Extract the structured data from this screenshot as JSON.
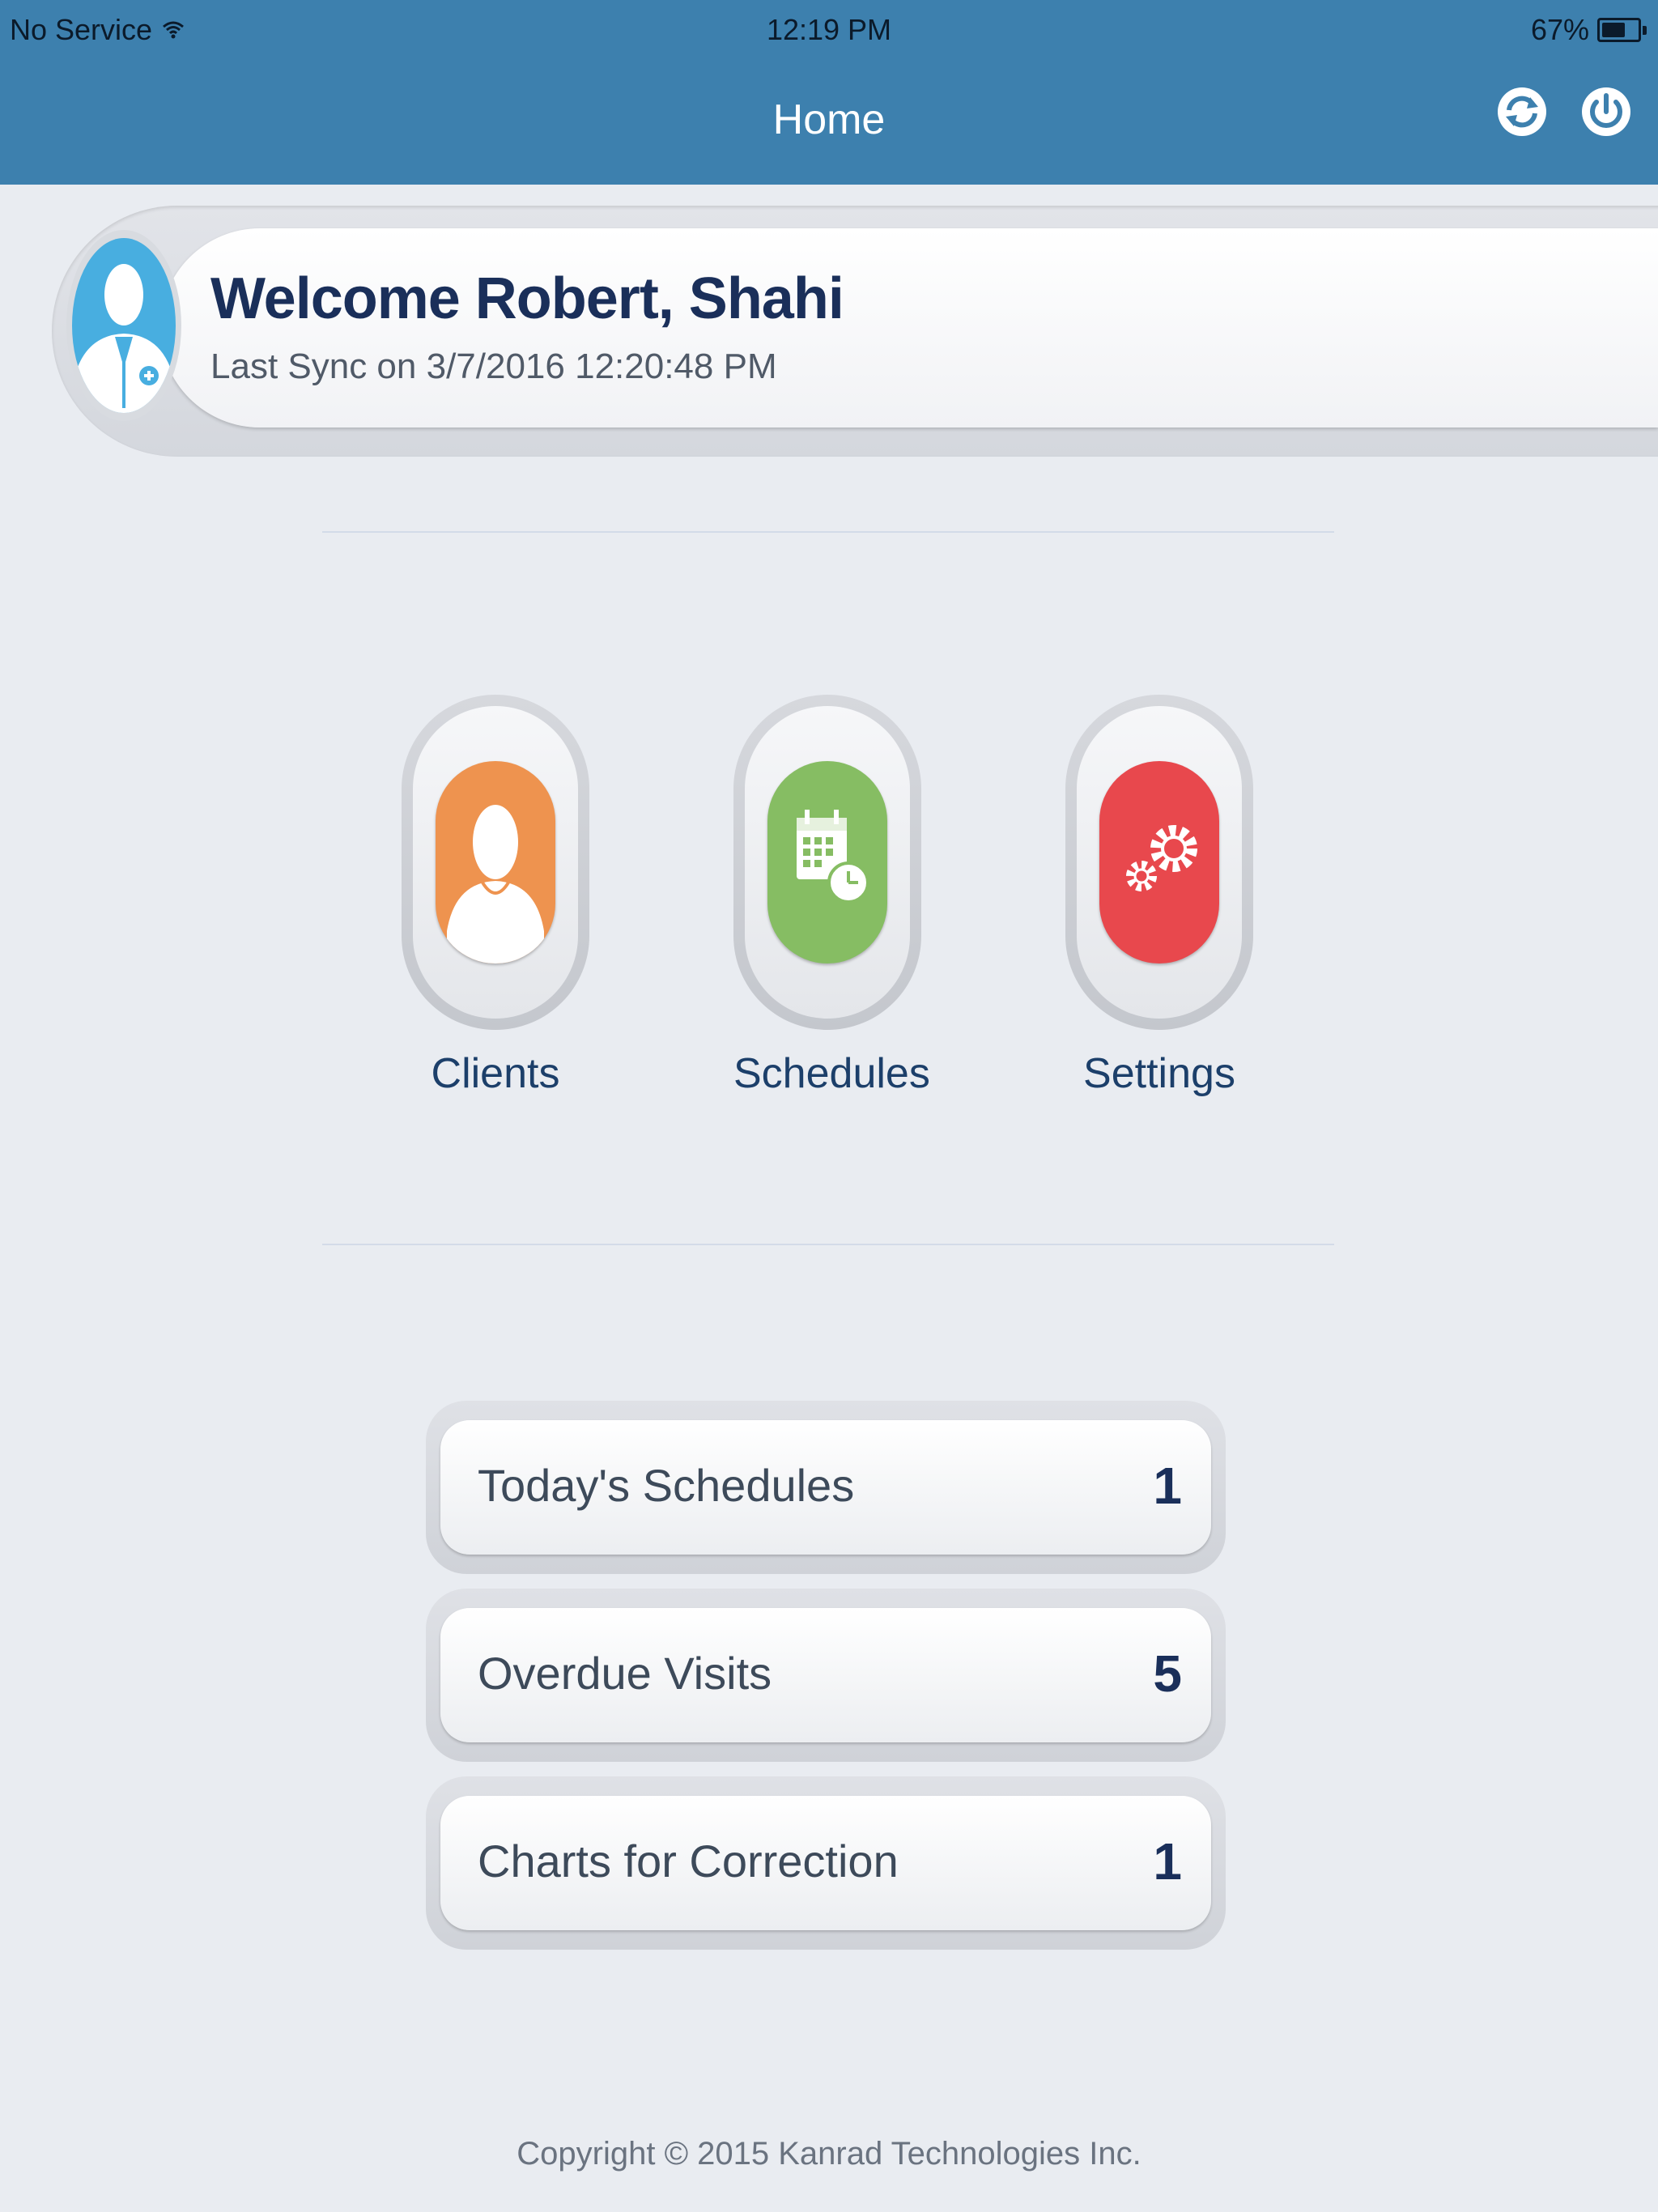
{
  "status_bar": {
    "carrier": "No Service",
    "time": "12:19 PM",
    "battery": "67%",
    "battery_level": 0.67
  },
  "nav": {
    "title": "Home",
    "sync_icon": "sync-icon",
    "power_icon": "power-icon"
  },
  "welcome": {
    "name": "Welcome Robert, Shahi",
    "last_sync": "Last Sync on 3/7/2016 12:20:48 PM",
    "avatar_icon": "doctor-avatar-icon"
  },
  "tiles": [
    {
      "label": "Clients",
      "icon": "client-person-icon",
      "color": "#ee934f"
    },
    {
      "label": "Schedules",
      "icon": "calendar-clock-icon",
      "color": "#86bd63"
    },
    {
      "label": "Settings",
      "icon": "gears-icon",
      "color": "#e8484d"
    }
  ],
  "summary": [
    {
      "label": "Today's Schedules",
      "count": "1"
    },
    {
      "label": "Overdue Visits",
      "count": "5"
    },
    {
      "label": "Charts for Correction",
      "count": "1"
    }
  ],
  "footer": {
    "copyright": "Copyright © 2015 Kanrad Technologies Inc."
  }
}
